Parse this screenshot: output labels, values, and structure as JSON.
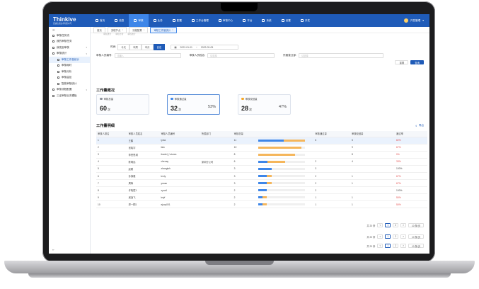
{
  "app": {
    "logo": "Thinkive",
    "logo_sub": "思迪信息技术有限公司",
    "user": "开发管理"
  },
  "topnav": [
    "首页",
    "信息",
    "审核",
    "业务",
    "配置",
    "工作台管理",
    "审核中心",
    "平台",
    "系统",
    "设置",
    "开发"
  ],
  "sidebar": {
    "items": [
      {
        "label": "审核任务流",
        "type": "item"
      },
      {
        "label": "我的审核任务",
        "type": "item"
      },
      {
        "label": "我发起审核",
        "type": "group"
      },
      {
        "label": "审核统计",
        "type": "group"
      },
      {
        "label": "审核工作量统计",
        "type": "sub",
        "active": true
      },
      {
        "label": "审核耗时",
        "type": "sub"
      },
      {
        "label": "审核分析",
        "type": "sub"
      },
      {
        "label": "审核监控",
        "type": "sub"
      },
      {
        "label": "智能审核统计",
        "type": "sub"
      },
      {
        "label": "审核流程配置",
        "type": "group"
      },
      {
        "label": "三证审核业务模板",
        "type": "item"
      }
    ]
  },
  "tabs": [
    {
      "label": "首页"
    },
    {
      "label": "流程节点"
    },
    {
      "label": "流程配置"
    },
    {
      "label": "审核工作量统计",
      "active": true
    }
  ],
  "ghost_tabs": [
    "审核统计",
    "审核分析",
    "审核统计"
  ],
  "filters": {
    "time_label": "时间:",
    "time_options": [
      {
        "label": "今天"
      },
      {
        "label": "本周"
      },
      {
        "label": "本月"
      },
      {
        "label": "自定",
        "active": true
      }
    ],
    "date_start": "2022-01-01",
    "date_sep": "~",
    "date_end": "2022-09-05",
    "reviewer_id_label": "审核人员编号:",
    "reviewer_id_placeholder": "请输入",
    "reviewer_name_label": "审核人员姓名:",
    "reviewer_name_placeholder": "请选择",
    "dept_label": "所属营业部:",
    "dept_placeholder": "请选择",
    "reset": "重置",
    "query": "查询"
  },
  "overview": {
    "title": "工作量概况",
    "cards": [
      {
        "title": "审核总量",
        "value": "60",
        "unit": "次",
        "pct": "",
        "color": "#8a8f99"
      },
      {
        "title": "审核通过量",
        "value": "32",
        "unit": "次",
        "pct": "53%",
        "color": "#3e86e8",
        "highlight": true
      },
      {
        "title": "审核驳回量",
        "value": "28",
        "unit": "次",
        "pct": "47%",
        "color": "#f5a623"
      }
    ]
  },
  "detail": {
    "title": "工作量明细",
    "export": "导出",
    "columns": [
      "审核人排名",
      "审核人员姓名",
      "审核人员编号",
      "所属部门",
      "审核总量",
      "",
      "审核通过量",
      "审核驳回量",
      "通过率"
    ],
    "rows": [
      {
        "rank": "1",
        "name": "王鹏",
        "code": "lyeia",
        "dept": "",
        "total": "11",
        "pass": "6",
        "reject": "5",
        "rate": "82%",
        "bar_total": 1.0,
        "bar_pass": 0.55,
        "selected": true
      },
      {
        "rank": "2",
        "name": "张晓宇",
        "code": "falo",
        "dept": "",
        "total": "10",
        "pass": "",
        "reject": "9",
        "rate": "67%",
        "bar_total": 0.92,
        "bar_pass": 0.0
      },
      {
        "rank": "3",
        "name": "李思思琪",
        "code": "fnartel_f utures",
        "dept": "",
        "total": "8",
        "pass": "",
        "reject": "8",
        "rate": "0%",
        "bar_total": 0.78,
        "bar_pass": 0.0
      },
      {
        "rank": "4",
        "name": "陈明远",
        "code": "chenay",
        "dept": "深圳分公司",
        "total": "6",
        "pass": "2",
        "reject": "4",
        "rate": "33%",
        "bar_total": 0.58,
        "bar_pass": 0.2
      },
      {
        "rank": "5",
        "name": "赵刚",
        "code": "zhangtsh",
        "dept": "",
        "total": "3",
        "pass": "3",
        "reject": "",
        "rate": "100%",
        "bar_total": 0.28,
        "bar_pass": 0.28
      },
      {
        "rank": "6",
        "name": "孙静雅",
        "code": "leniy",
        "dept": "",
        "total": "3",
        "pass": "2",
        "reject": "1",
        "rate": "67%",
        "bar_total": 0.28,
        "bar_pass": 0.18
      },
      {
        "rank": "7",
        "name": "周辉",
        "code": "yrwan",
        "dept": "",
        "total": "3",
        "pass": "2",
        "reject": "1",
        "rate": "67%",
        "bar_total": 0.28,
        "bar_pass": 0.18
      },
      {
        "rank": "8",
        "name": "许晓斌1",
        "code": "zyna1",
        "dept": "",
        "total": "2",
        "pass": "2",
        "reject": "",
        "rate": "100%",
        "bar_total": 0.18,
        "bar_pass": 0.18
      },
      {
        "rank": "9",
        "name": "吴凌飞",
        "code": "leiyf",
        "dept": "",
        "total": "2",
        "pass": "1",
        "reject": "1",
        "rate": "50%",
        "bar_total": 0.18,
        "bar_pass": 0.09
      },
      {
        "rank": "10",
        "name": "郑一桐1",
        "code": "ejocy001",
        "dept": "",
        "total": "2",
        "pass": "1",
        "reject": "1",
        "rate": "50%",
        "bar_total": 0.18,
        "bar_pass": 0.09
      }
    ]
  },
  "pagination": {
    "page_size": "共 20 条",
    "current": "1",
    "next": "2",
    "per_page": "10 条/页",
    "prev": "<",
    "next_arrow": ">"
  },
  "colors": {
    "primary": "#1f5bb8",
    "bar_pass": "#3e86e8",
    "bar_total": "#f5b65b"
  }
}
